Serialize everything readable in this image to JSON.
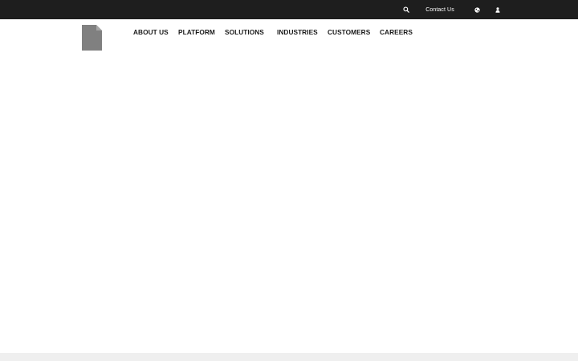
{
  "topbar": {
    "contact_label": "Contact Us",
    "icons": {
      "search": "search-icon",
      "globe": "globe-icon",
      "user": "user-icon"
    },
    "background": "#1e1e1e"
  },
  "logo": {
    "icon": "document-icon",
    "color": "#808080"
  },
  "nav": {
    "items": [
      {
        "label": "ABOUT US"
      },
      {
        "label": "PLATFORM"
      },
      {
        "label": "SOLUTIONS"
      },
      {
        "label": "INDUSTRIES"
      },
      {
        "label": "CUSTOMERS"
      },
      {
        "label": "CAREERS"
      }
    ]
  }
}
